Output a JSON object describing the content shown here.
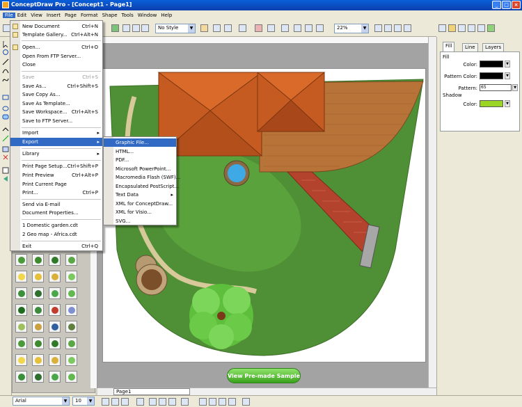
{
  "app": {
    "title": "ConceptDraw Pro - [Concept1 - Page1]"
  },
  "menubar": [
    "File",
    "Edit",
    "View",
    "Insert",
    "Page",
    "Format",
    "Shape",
    "Tools",
    "Window",
    "Help"
  ],
  "toolbar": {
    "style_combo": "No Style",
    "zoom_combo": "22%"
  },
  "file_menu": [
    {
      "label": "New Document",
      "shortcut": "Ctrl+N"
    },
    {
      "label": "Template Gallery...",
      "shortcut": "Ctrl+Alt+N"
    },
    {
      "label": "Open...",
      "shortcut": "Ctrl+O"
    },
    {
      "label": "Open From FTP Server...",
      "shortcut": ""
    },
    {
      "label": "Close",
      "shortcut": ""
    },
    {
      "label": "Save",
      "shortcut": "Ctrl+S"
    },
    {
      "label": "Save As...",
      "shortcut": "Ctrl+Shift+S"
    },
    {
      "label": "Save Copy As...",
      "shortcut": ""
    },
    {
      "label": "Save As Template...",
      "shortcut": ""
    },
    {
      "label": "Save Workspace...",
      "shortcut": "Ctrl+Alt+S"
    },
    {
      "label": "Save to FTP Server...",
      "shortcut": ""
    },
    {
      "label": "Import",
      "shortcut": ""
    },
    {
      "label": "Export",
      "shortcut": ""
    },
    {
      "label": "Library",
      "shortcut": ""
    },
    {
      "label": "Print Page Setup...",
      "shortcut": "Ctrl+Shift+P"
    },
    {
      "label": "Print Preview",
      "shortcut": "Ctrl+Alt+P"
    },
    {
      "label": "Print Current Page",
      "shortcut": ""
    },
    {
      "label": "Print...",
      "shortcut": "Ctrl+P"
    },
    {
      "label": "Send via E-mail",
      "shortcut": ""
    },
    {
      "label": "Document Properties...",
      "shortcut": ""
    },
    {
      "label": "1 Domestic garden.cdt",
      "shortcut": ""
    },
    {
      "label": "2 Geo map - Africa.cdt",
      "shortcut": ""
    },
    {
      "label": "Exit",
      "shortcut": "Ctrl+Q"
    }
  ],
  "export_menu": [
    "Graphic File...",
    "HTML...",
    "PDF...",
    "Microsoft PowerPoint...",
    "Macromedia Flash (SWF)...",
    "Encapsulated PostScript...",
    "Text Data",
    "XML for ConceptDraw...",
    "XML for Visio...",
    "SVG..."
  ],
  "properties": {
    "tabs": [
      "Fill",
      "Line",
      "Layers"
    ],
    "section_fill": "Fill",
    "color_label": "Color:",
    "pattern_color_label": "Pattern Color:",
    "pattern_label": "Pattern:",
    "pattern_value": "65",
    "section_shadow": "Shadow",
    "shadow_color_label": "Color:",
    "fill_color": "#000000",
    "pattern_color": "#000000",
    "shadow_color": "#9ad425"
  },
  "canvas": {
    "page_tab": "Page1",
    "sample_button": "View Pre-made Sample"
  },
  "format_bar": {
    "font": "Arial",
    "size": "10"
  }
}
